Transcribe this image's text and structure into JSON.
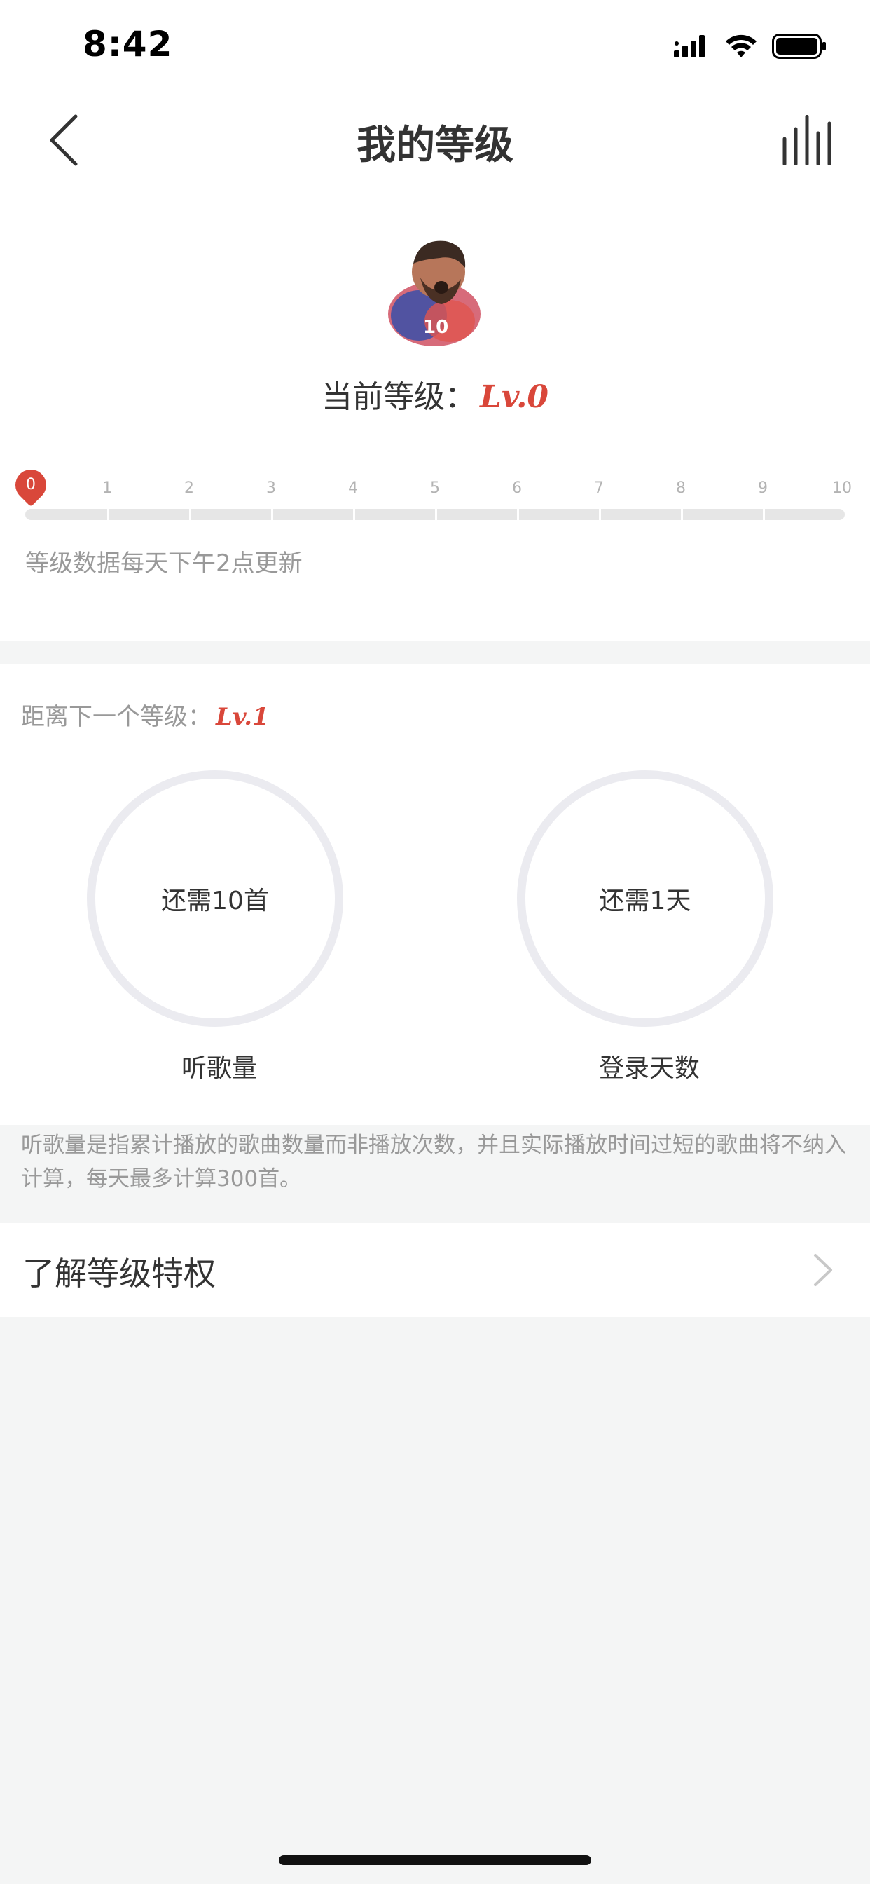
{
  "status_bar": {
    "time": "8:42"
  },
  "nav": {
    "title": "我的等级"
  },
  "level": {
    "current_label": "当前等级：",
    "current_value": "Lv.0"
  },
  "progress": {
    "ticks": [
      "0",
      "1",
      "2",
      "3",
      "4",
      "5",
      "6",
      "7",
      "8",
      "9",
      "10"
    ],
    "current_tick": "0",
    "note": "等级数据每天下午2点更新"
  },
  "next_level": {
    "label": "距离下一个等级：",
    "value": "Lv.1",
    "songs": {
      "remaining": "还需10首",
      "label": "听歌量"
    },
    "days": {
      "remaining": "还需1天",
      "label": "登录天数"
    }
  },
  "explanation": "听歌量是指累计播放的歌曲数量而非播放次数，并且实际播放时间过短的歌曲将不纳入计算，每天最多计算300首。",
  "privilege": {
    "label": "了解等级特权"
  },
  "colors": {
    "accent": "#d9473a",
    "ring": "#ebebf0",
    "background": "#f4f5f5"
  }
}
